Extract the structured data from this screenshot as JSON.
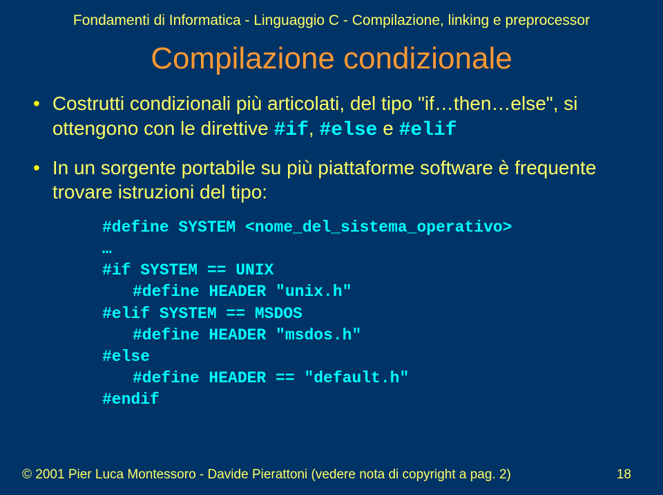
{
  "header": "Fondamenti di Informatica - Linguaggio C - Compilazione, linking e preprocessor",
  "title": "Compilazione condizionale",
  "bullets": {
    "b1_pre": "Costrutti condizionali più articolati, del tipo \"if…then…else\", si ottengono con le direttive ",
    "b1_c1": "#if",
    "b1_mid1": ", ",
    "b1_c2": "#else",
    "b1_mid2": " e ",
    "b1_c3": "#elif",
    "b2": "In un sorgente portabile su più piattaforme software è frequente trovare istruzioni del tipo:"
  },
  "code": {
    "l1": "#define SYSTEM <nome_del_sistema_operativo>",
    "l2": "…",
    "l3": "#if SYSTEM == UNIX",
    "l4": "#define HEADER \"unix.h\"",
    "l5": "#elif SYSTEM == MSDOS",
    "l6": "#define HEADER \"msdos.h\"",
    "l7": "#else",
    "l8": "#define HEADER == \"default.h\"",
    "l9": "#endif"
  },
  "footer": {
    "copyright": "© 2001   Pier Luca Montessoro - Davide Pierattoni (vedere nota di copyright a pag. 2)",
    "page": "18"
  }
}
